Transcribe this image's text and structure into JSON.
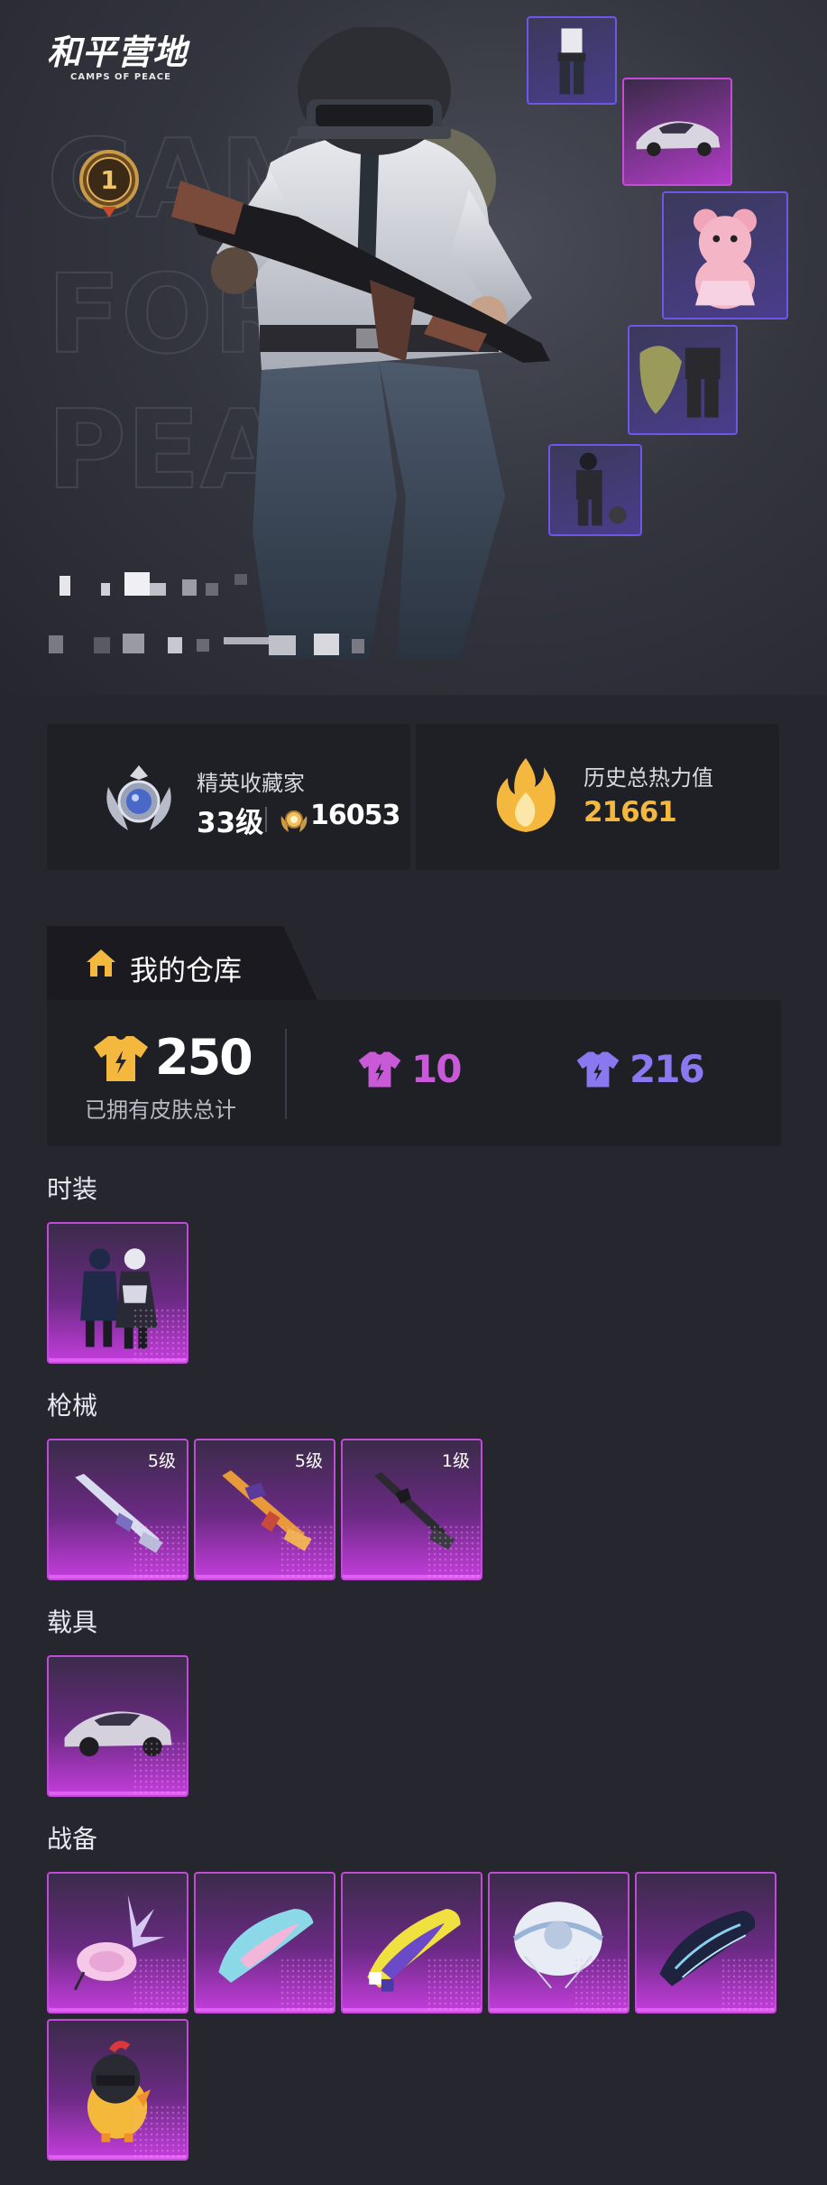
{
  "brand": {
    "name_cn": "和平营地",
    "name_en": "CAMPS OF PEACE"
  },
  "hero": {
    "watermark": "GAME FOR PEACE",
    "rank_number": "1"
  },
  "stats": {
    "collector_title": "精英收藏家",
    "collector_level": "33级",
    "collector_coins": "16053",
    "heat_title": "历史总热力值",
    "heat_value": "21661"
  },
  "warehouse": {
    "title": "我的仓库",
    "total_count": "250",
    "total_label": "已拥有皮肤总计",
    "pink_count": "10",
    "purple_count": "216"
  },
  "categories": {
    "fashion": {
      "label": "时装"
    },
    "weapons": {
      "label": "枪械",
      "levels": [
        "5级",
        "5级",
        "1级"
      ]
    },
    "vehicles": {
      "label": "载具"
    },
    "gear": {
      "label": "战备"
    }
  },
  "colors": {
    "background": "#26262e",
    "card": "#1f1f26",
    "gold": "#f5b83e",
    "pink_rarity": "#c85ad8",
    "purple_rarity": "#8a78f0"
  }
}
